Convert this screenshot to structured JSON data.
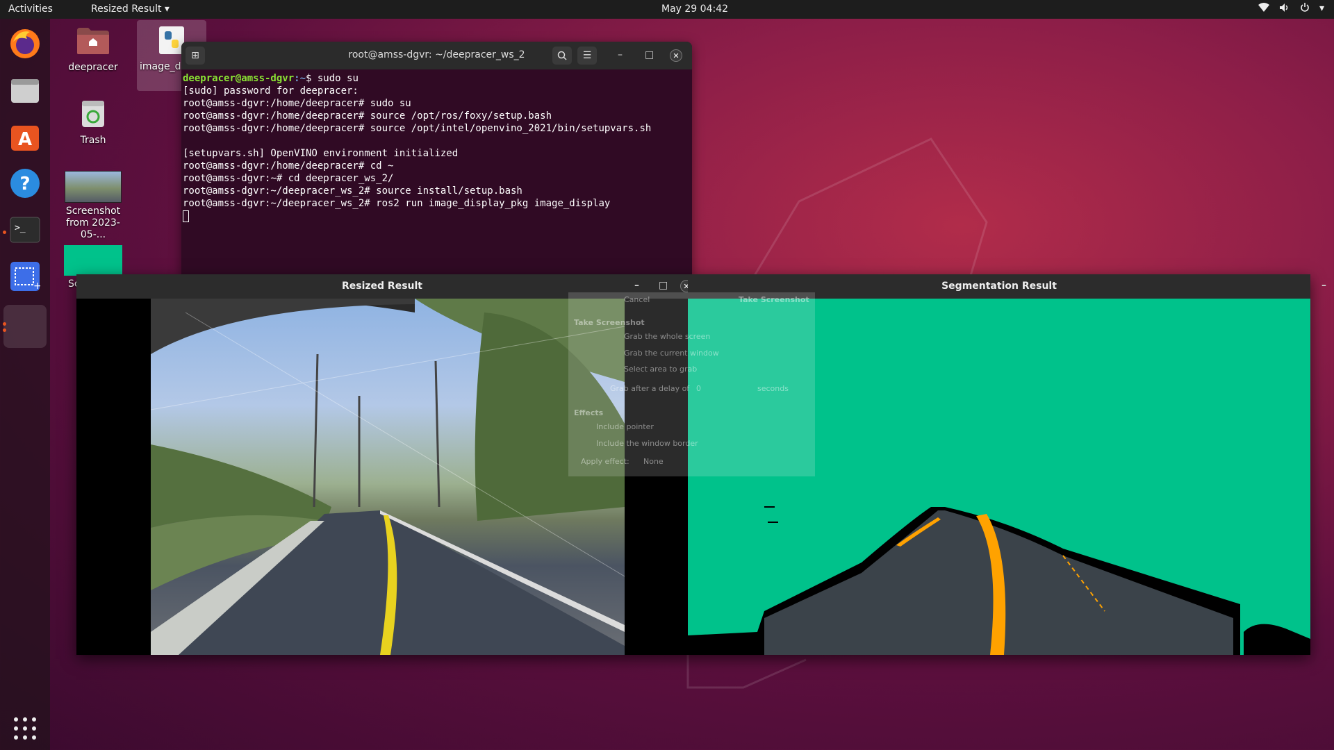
{
  "topbar": {
    "activities": "Activities",
    "app_menu": "Resized Result",
    "clock": "May 29  04:42",
    "tray_icons": [
      "wifi-icon",
      "volume-icon",
      "power-icon",
      "chevron-down-icon"
    ]
  },
  "dock": {
    "items": [
      "firefox-icon",
      "files-icon",
      "software-icon",
      "help-icon",
      "terminal-icon",
      "screenshot-icon",
      "active-window-icon"
    ],
    "show_apps": "apps-grid-icon"
  },
  "desktop": {
    "icons": [
      {
        "label": "deepracer"
      },
      {
        "label": "image_d"
      },
      {
        "label": "Trash"
      },
      {
        "label": "Screenshot from 2023-05-..."
      },
      {
        "label": "Sc from"
      }
    ]
  },
  "terminal": {
    "title": "root@amss-dgvr: ~/deepracer_ws_2",
    "lines": [
      "[sudo] password for deepracer:",
      "root@amss-dgvr:/home/deepracer# sudo su",
      "root@amss-dgvr:/home/deepracer# source /opt/ros/foxy/setup.bash",
      "root@amss-dgvr:/home/deepracer# source /opt/intel/openvino_2021/bin/setupvars.sh",
      "",
      "[setupvars.sh] OpenVINO environment initialized",
      "root@amss-dgvr:/home/deepracer# cd ~",
      "root@amss-dgvr:~# cd deepracer_ws_2/",
      "root@amss-dgvr:~/deepracer_ws_2# source install/setup.bash",
      "root@amss-dgvr:~/deepracer_ws_2# ros2 run image_display_pkg image_display"
    ],
    "first_prompt_user": "deepracer@amss-dgvr",
    "first_prompt_path": ":~",
    "first_prompt_cmd": "$ sudo su"
  },
  "resized_window": {
    "title": "Resized Result"
  },
  "segmentation_window": {
    "title": "Segmentation Result"
  },
  "ghost_dialog": {
    "cancel": "Cancel",
    "take": "Take Screenshot",
    "heading": "Take Screenshot",
    "opt1": "Grab the whole screen",
    "opt2": "Grab the current window",
    "opt3": "Select area to grab",
    "delay_label": "Grab after a delay of",
    "delay_value": "0",
    "delay_unit": "seconds",
    "effects": "Effects",
    "pointer": "Include pointer",
    "border": "Include the window border",
    "apply": "Apply effect:",
    "effect_value": "None"
  },
  "colors": {
    "seg_background": "#00c28b",
    "road": "#3b434a",
    "lane": "#ffa200",
    "terminal_bg": "#300a24"
  }
}
